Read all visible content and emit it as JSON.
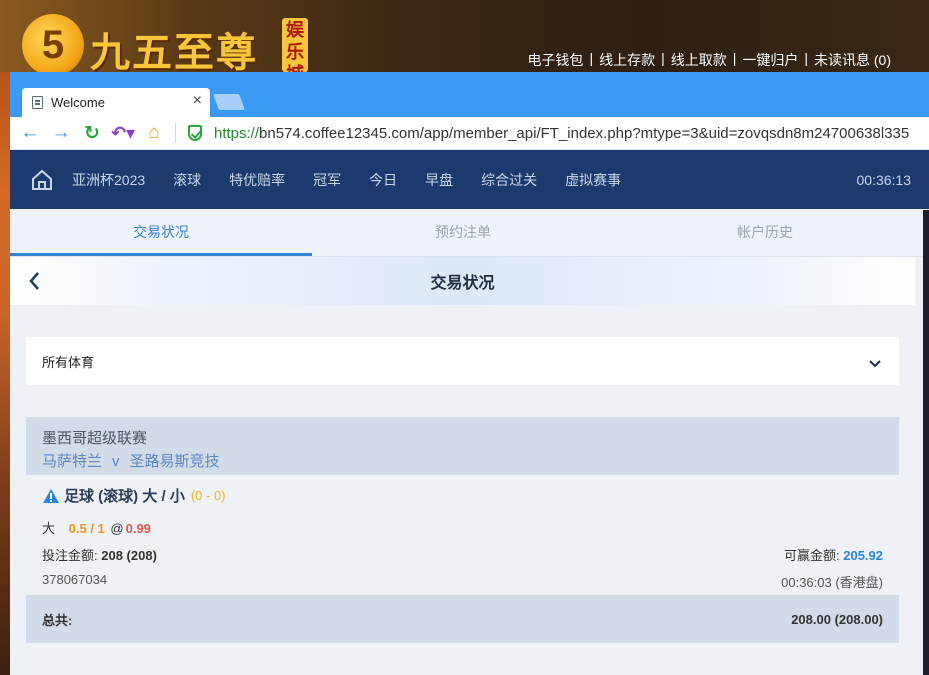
{
  "site": {
    "logo_digit": "5",
    "logo_text": "九五至尊",
    "logo_badge": "娱乐城",
    "top_links": [
      "电子钱包",
      "线上存款",
      "线上取款",
      "一键归户",
      "未读讯息 (0)"
    ]
  },
  "browser": {
    "tab_title": "Welcome",
    "url_scheme": "https://",
    "url_rest": "bn574.coffee12345.com/app/member_api/FT_index.php?mtype=3&uid=zovqsdn8m24700638l335"
  },
  "nav": {
    "items": [
      "亚洲杯2023",
      "滚球",
      "特优赔率",
      "冠军",
      "今日",
      "早盘",
      "综合过关",
      "虚拟赛事"
    ],
    "time": "00:36:13"
  },
  "subtabs": [
    "交易状况",
    "预约注单",
    "帐户历史"
  ],
  "page_title": "交易状况",
  "sport_filter": "所有体育",
  "bet": {
    "league": "墨西哥超级联赛",
    "home": "马萨特兰",
    "vs": "v",
    "away": "圣路易斯竞技",
    "type": "足球 (滚球) 大 / 小",
    "score": "(0 - 0)",
    "selection": "大",
    "handicap": "0.5 / 1",
    "at": "@",
    "odds": "0.99",
    "stake_label": "投注金额:",
    "stake_value": "208 (208)",
    "win_label": "可赢金额:",
    "win_value": "205.92",
    "ticket_id": "378067034",
    "placed_time": "00:36:03 (香港盘)"
  },
  "total": {
    "label": "总共:",
    "value": "208.00 (208.00)"
  },
  "colors": {
    "nav_bg": "#1c3a6e",
    "tabbar_bg": "#3b9bf4",
    "active_tab": "#3682d4",
    "odds": "#e0584a",
    "handicap": "#f0941a",
    "win": "#2a86d8"
  }
}
